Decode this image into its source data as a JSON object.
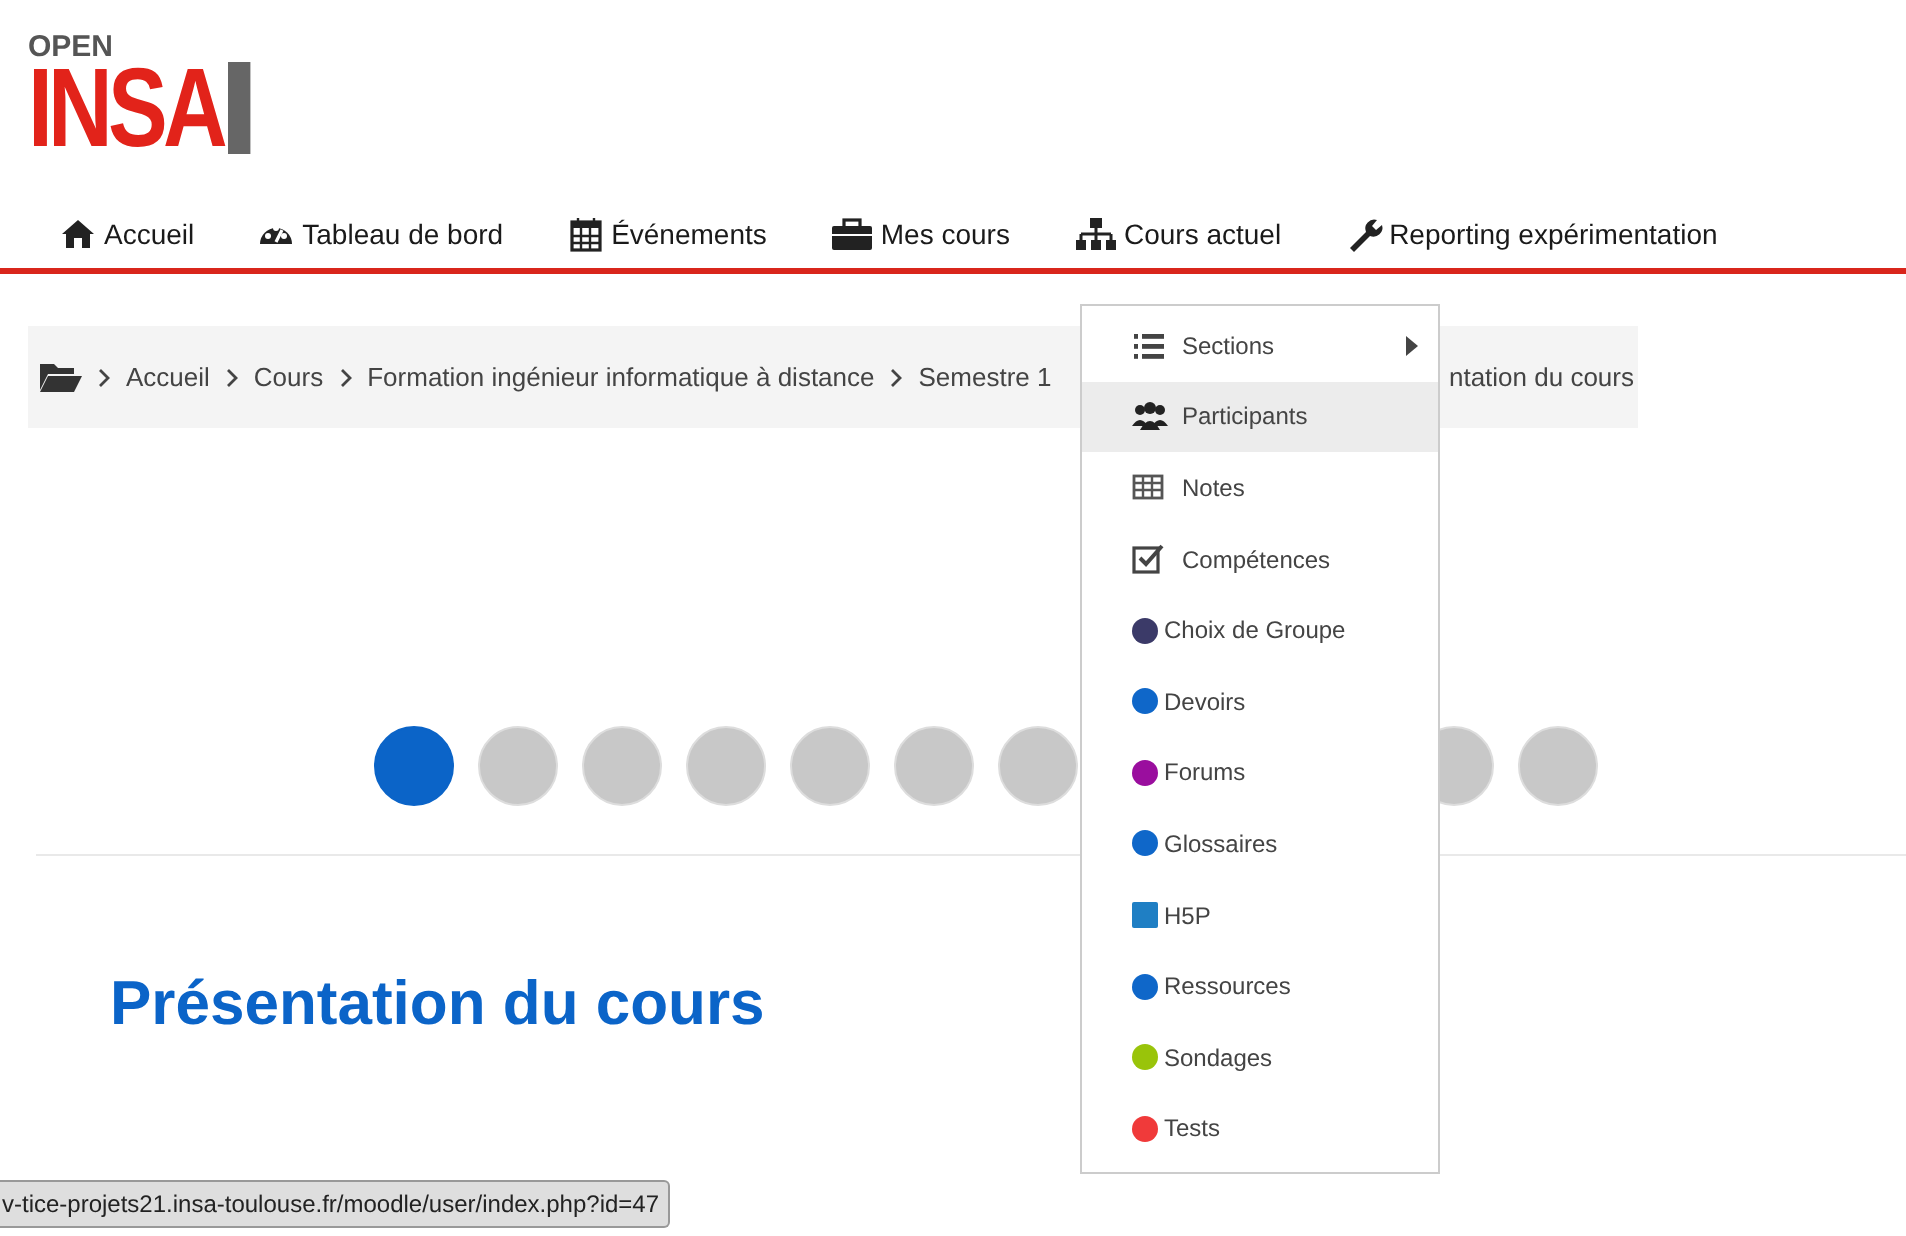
{
  "logo": {
    "top": "OPEN",
    "main": "INSA"
  },
  "nav": [
    {
      "label": "Accueil"
    },
    {
      "label": "Tableau de bord"
    },
    {
      "label": "Événements"
    },
    {
      "label": "Mes cours"
    },
    {
      "label": "Cours actuel"
    },
    {
      "label": "Reporting expérimentation"
    }
  ],
  "breadcrumb": {
    "items": [
      "Accueil",
      "Cours",
      "Formation ingénieur informatique à distance",
      "Semestre 1"
    ],
    "last": "ntation du cours"
  },
  "dots": [
    {
      "selected": true
    },
    {
      "selected": false
    },
    {
      "selected": false
    },
    {
      "selected": false
    },
    {
      "selected": false
    },
    {
      "selected": false
    },
    {
      "selected": false
    },
    {
      "selected": false
    },
    {
      "selected": false
    }
  ],
  "heading": "Présentation du cours",
  "dropdown": [
    {
      "label": "Sections",
      "kind": "fa",
      "submenu": true,
      "selected": false
    },
    {
      "label": "Participants",
      "kind": "fa",
      "submenu": false,
      "selected": true
    },
    {
      "label": "Notes",
      "kind": "fa",
      "submenu": false,
      "selected": false
    },
    {
      "label": "Compétences",
      "kind": "fa",
      "submenu": false,
      "selected": false
    },
    {
      "label": "Choix de Groupe",
      "kind": "mod",
      "color": "#3b3a68",
      "submenu": false,
      "selected": false
    },
    {
      "label": "Devoirs",
      "kind": "mod",
      "color": "#0f67c9",
      "submenu": false,
      "selected": false
    },
    {
      "label": "Forums",
      "kind": "mod",
      "color": "#9a0e9e",
      "submenu": false,
      "selected": false
    },
    {
      "label": "Glossaires",
      "kind": "mod",
      "color": "#0f67c9",
      "submenu": false,
      "selected": false
    },
    {
      "label": "H5P",
      "kind": "square",
      "color": "#1f7fc4",
      "submenu": false,
      "selected": false
    },
    {
      "label": "Ressources",
      "kind": "mod",
      "color": "#0f67c9",
      "submenu": false,
      "selected": false
    },
    {
      "label": "Sondages",
      "kind": "mod",
      "color": "#99c40a",
      "submenu": false,
      "selected": false
    },
    {
      "label": "Tests",
      "kind": "mod",
      "color": "#f03a3a",
      "submenu": false,
      "selected": false
    }
  ],
  "status_url": "v-tice-projets21.insa-toulouse.fr/moodle/user/index.php?id=47"
}
